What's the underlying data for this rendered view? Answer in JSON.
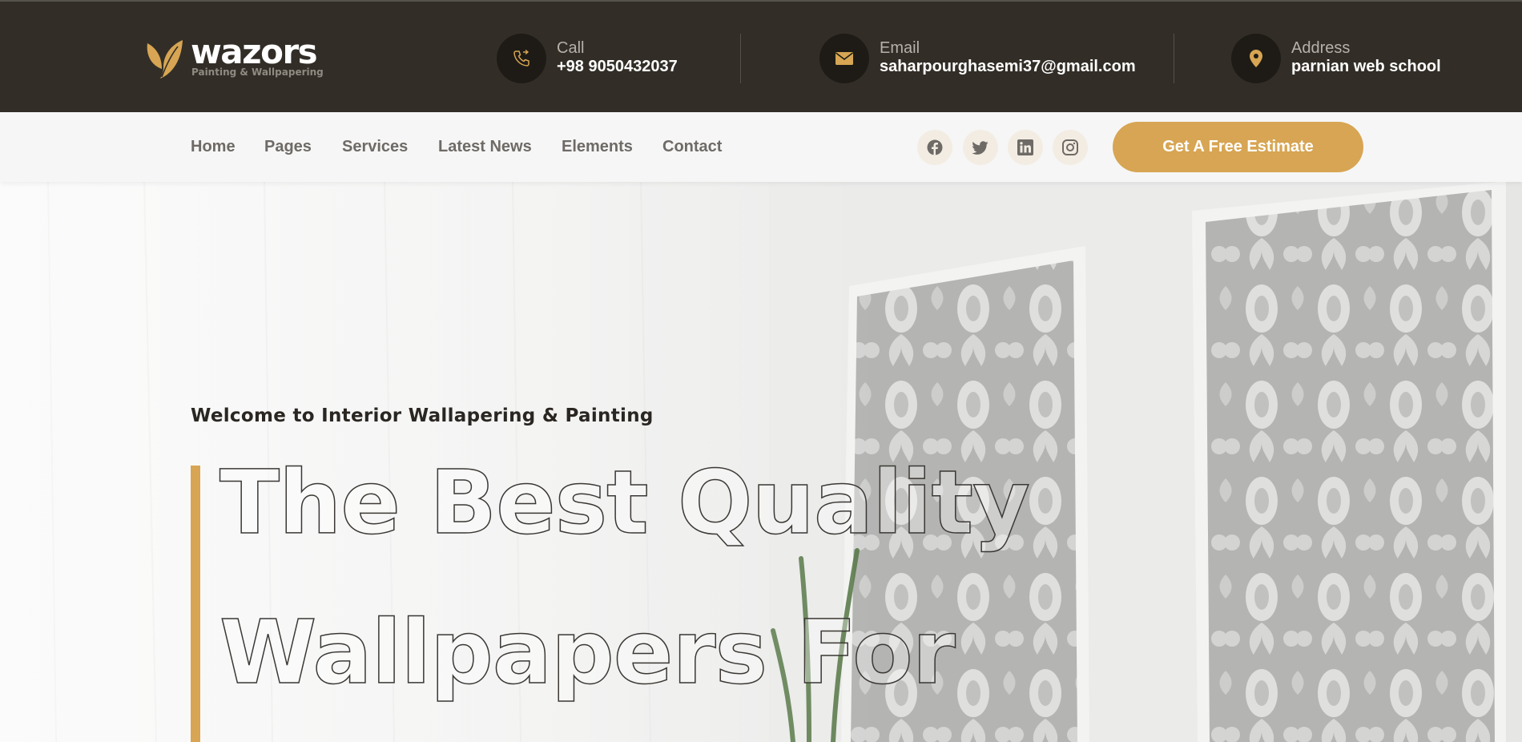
{
  "brand": {
    "name": "wazors",
    "tagline": "Painting & Wallpapering",
    "accent_color": "#d7a553",
    "dark_color": "#322e27"
  },
  "contacts": [
    {
      "icon": "phone-icon",
      "label": "Call",
      "value": "+98 9050432037"
    },
    {
      "icon": "envelope-icon",
      "label": "Email",
      "value": "saharpourghasemi37@gmail.com"
    },
    {
      "icon": "map-pin-icon",
      "label": "Address",
      "value": "parnian web school"
    }
  ],
  "nav": {
    "items": [
      "Home",
      "Pages",
      "Services",
      "Latest News",
      "Elements",
      "Contact"
    ],
    "social": [
      "facebook-icon",
      "twitter-icon",
      "linkedin-icon",
      "instagram-icon"
    ],
    "cta_label": "Get A Free Estimate"
  },
  "hero": {
    "subtitle": "Welcome to Interior Wallapering & Painting",
    "headline_line1": "The Best Quality",
    "headline_line2": "Wallpapers For"
  }
}
